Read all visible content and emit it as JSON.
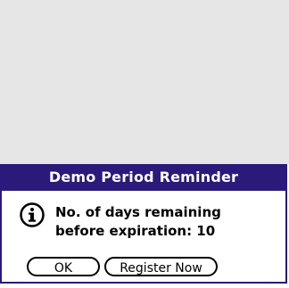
{
  "dialog": {
    "title": "Demo Period Reminder",
    "icon": "info-icon",
    "message": "No. of days remaining\nbefore expiration: 10"
  },
  "buttons": {
    "ok_label": "OK",
    "register_label": "Register Now"
  },
  "colors": {
    "titlebar": "#2b1a7a",
    "backdrop": "#e6e6e6",
    "dialog_background": "#ffffff"
  }
}
